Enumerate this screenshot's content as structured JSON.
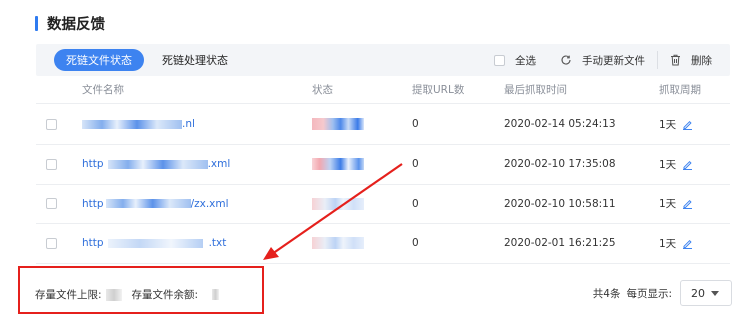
{
  "header": {
    "title": "数据反馈"
  },
  "toolbar": {
    "tabs": [
      {
        "label": "死链文件状态",
        "active": true
      },
      {
        "label": "死链处理状态",
        "active": false
      }
    ],
    "select_all_label": "全选",
    "refresh_label": "手动更新文件",
    "delete_label": "删除"
  },
  "table": {
    "columns": [
      "文件名称",
      "状态",
      "提取URL数",
      "最后抓取时间",
      "抓取周期"
    ],
    "rows": [
      {
        "name_suffix": ".nl",
        "count": "0",
        "time": "2020-02-14 05:24:13",
        "period": "1天"
      },
      {
        "name_prefix": "http",
        "name_suffix": ".xml",
        "count": "0",
        "time": "2020-02-10 17:35:08",
        "period": "1天"
      },
      {
        "name_prefix": "http",
        "name_suffix": "/zx.xml",
        "count": "0",
        "time": "2020-02-10 10:58:11",
        "period": "1天"
      },
      {
        "name_prefix": "http",
        "name_suffix": ".txt",
        "count": "0",
        "time": "2020-02-01 16:21:25",
        "period": "1天"
      }
    ]
  },
  "footer": {
    "storage_limit_label": "存量文件上限:",
    "storage_remaining_label": "存量文件余额:",
    "total_label": "共4条",
    "per_page_label": "每页显示:",
    "per_page_value": "20"
  },
  "colors": {
    "accent": "#3d83f0",
    "link": "#2f6fdb",
    "annotation": "#e5201c"
  }
}
